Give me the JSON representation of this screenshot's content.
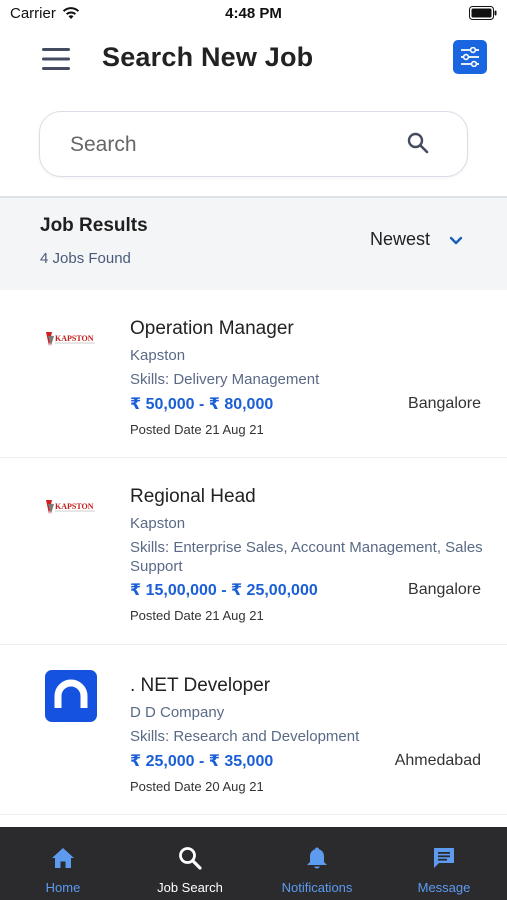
{
  "status_bar": {
    "carrier": "Carrier",
    "time": "4:48 PM"
  },
  "header": {
    "title": "Search New Job"
  },
  "search": {
    "placeholder": "Search",
    "value": ""
  },
  "results": {
    "title": "Job Results",
    "count_text": "4 Jobs Found",
    "sort_selected": "Newest"
  },
  "jobs": [
    {
      "logo": "kapston-logo",
      "logo_text": "KAPSTON",
      "title": "Operation Manager",
      "company": "Kapston",
      "skills": "Skills: Delivery Management",
      "salary": "₹ 50,000 - ₹ 80,000",
      "location": "Bangalore",
      "posted": "Posted Date 21 Aug 21"
    },
    {
      "logo": "kapston-logo",
      "logo_text": "KAPSTON",
      "title": "Regional Head",
      "company": "Kapston",
      "skills": "Skills: Enterprise Sales, Account Management, Sales Support",
      "salary": "₹ 15,00,000 - ₹ 25,00,000",
      "location": "Bangalore",
      "posted": "Posted Date 21 Aug 21"
    },
    {
      "logo": "dd-company-logo",
      "title": ". NET Developer",
      "company": "D D Company",
      "skills": "Skills: Research and Development",
      "salary": "₹ 25,000 - ₹ 35,000",
      "location": "Ahmedabad",
      "posted": "Posted Date 20 Aug 21"
    }
  ],
  "bottom_nav": {
    "items": [
      {
        "label": "Home",
        "icon": "home-icon"
      },
      {
        "label": "Job Search",
        "icon": "search-icon"
      },
      {
        "label": "Notifications",
        "icon": "bell-icon"
      },
      {
        "label": "Message",
        "icon": "message-icon"
      }
    ],
    "active_index": 1
  },
  "colors": {
    "accent": "#1a66e0",
    "salary": "#1b5fd6",
    "nav_background": "#2b2a2c",
    "nav_inactive": "#5d9bf0",
    "nav_active": "#ffffff",
    "results_background": "#f4f5f7"
  }
}
